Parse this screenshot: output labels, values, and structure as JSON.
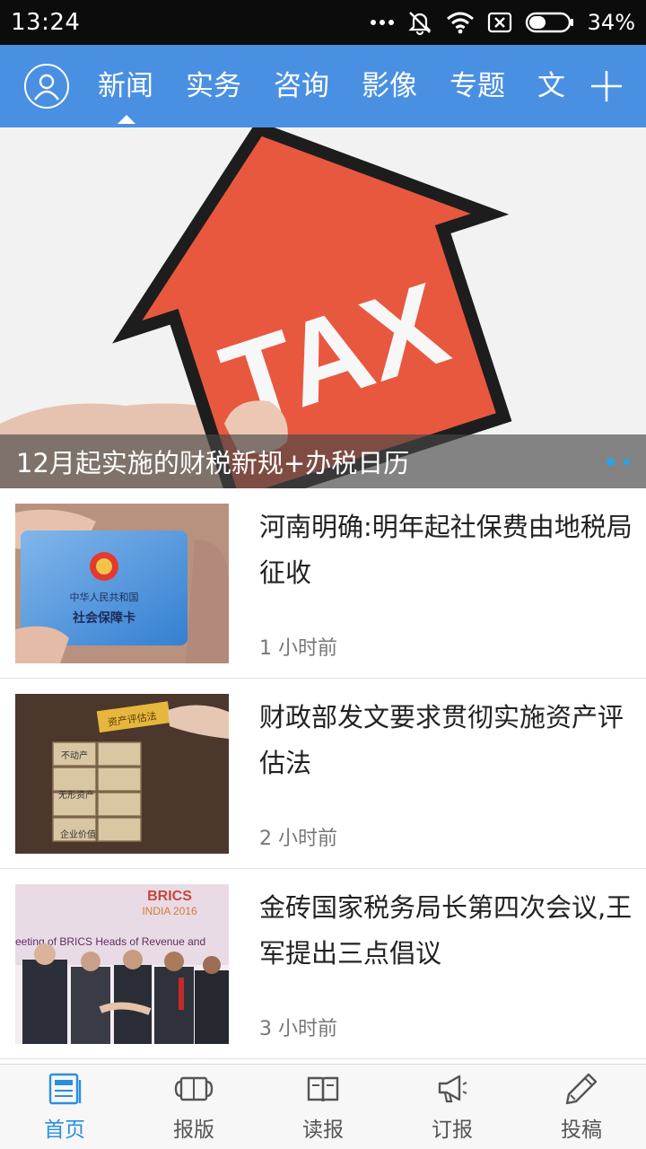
{
  "status_bar": {
    "time": "13:24",
    "battery": "34%",
    "icons": [
      "more-dots-icon",
      "mute-icon",
      "wifi-icon",
      "sim-off-icon",
      "battery-icon"
    ]
  },
  "header": {
    "tabs": [
      {
        "label": "新闻",
        "active": true
      },
      {
        "label": "实务"
      },
      {
        "label": "咨询"
      },
      {
        "label": "影像"
      },
      {
        "label": "专题"
      },
      {
        "label": "文化"
      }
    ],
    "accent": "#4a90e2"
  },
  "hero": {
    "caption": "12月起实施的财税新规+办税日历",
    "image_text": "TAX",
    "slides": 2,
    "current_slide": 1
  },
  "news": [
    {
      "title": "河南明确:明年起社保费由地税局征收",
      "time": "1 小时前",
      "thumb": {
        "line1": "中华人民共和国",
        "line2": "社会保障卡"
      }
    },
    {
      "title": "财政部发文要求贯彻实施资产评估法",
      "time": "2 小时前",
      "thumb": {
        "gold": "资产评估法",
        "b1": "不动产",
        "b2": "无形资产",
        "b3": "企业价值"
      }
    },
    {
      "title": "金砖国家税务局长第四次会议,王军提出三点倡议",
      "time": "3 小时前",
      "thumb": {
        "brand": "BRICS",
        "sub": "INDIA 2016",
        "banner": "eeting of BRICS Heads of Revenue and"
      }
    }
  ],
  "bottom_nav": {
    "items": [
      {
        "label": "首页",
        "icon": "news-home-icon",
        "active": true
      },
      {
        "label": "报版",
        "icon": "newspaper-layout-icon"
      },
      {
        "label": "读报",
        "icon": "open-book-icon"
      },
      {
        "label": "订报",
        "icon": "megaphone-icon"
      },
      {
        "label": "投稿",
        "icon": "pen-icon"
      }
    ],
    "active_color": "#2b8ee0"
  }
}
